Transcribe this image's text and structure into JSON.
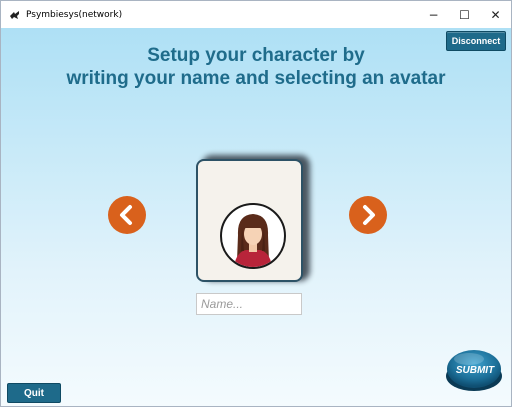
{
  "window": {
    "title": "Psymbiesys(network)",
    "controls": {
      "minimize": "−",
      "maximize": "☐",
      "close": "✕"
    }
  },
  "header": {
    "disconnect_label": "Disconnect",
    "heading_line1": "Setup your character by",
    "heading_line2": "writing your name and selecting an avatar"
  },
  "avatar_selector": {
    "prev_icon": "chevron-left-icon",
    "next_icon": "chevron-right-icon",
    "current_avatar": "girl-avatar-icon"
  },
  "name_field": {
    "value": "",
    "placeholder": "Name..."
  },
  "footer": {
    "submit_label": "SUBMIT",
    "quit_label": "Quit"
  },
  "colors": {
    "accent": "#1e6a8a",
    "heading": "#1f6c8b",
    "arrow": "#d9611c",
    "submit": "#1c6f98"
  }
}
